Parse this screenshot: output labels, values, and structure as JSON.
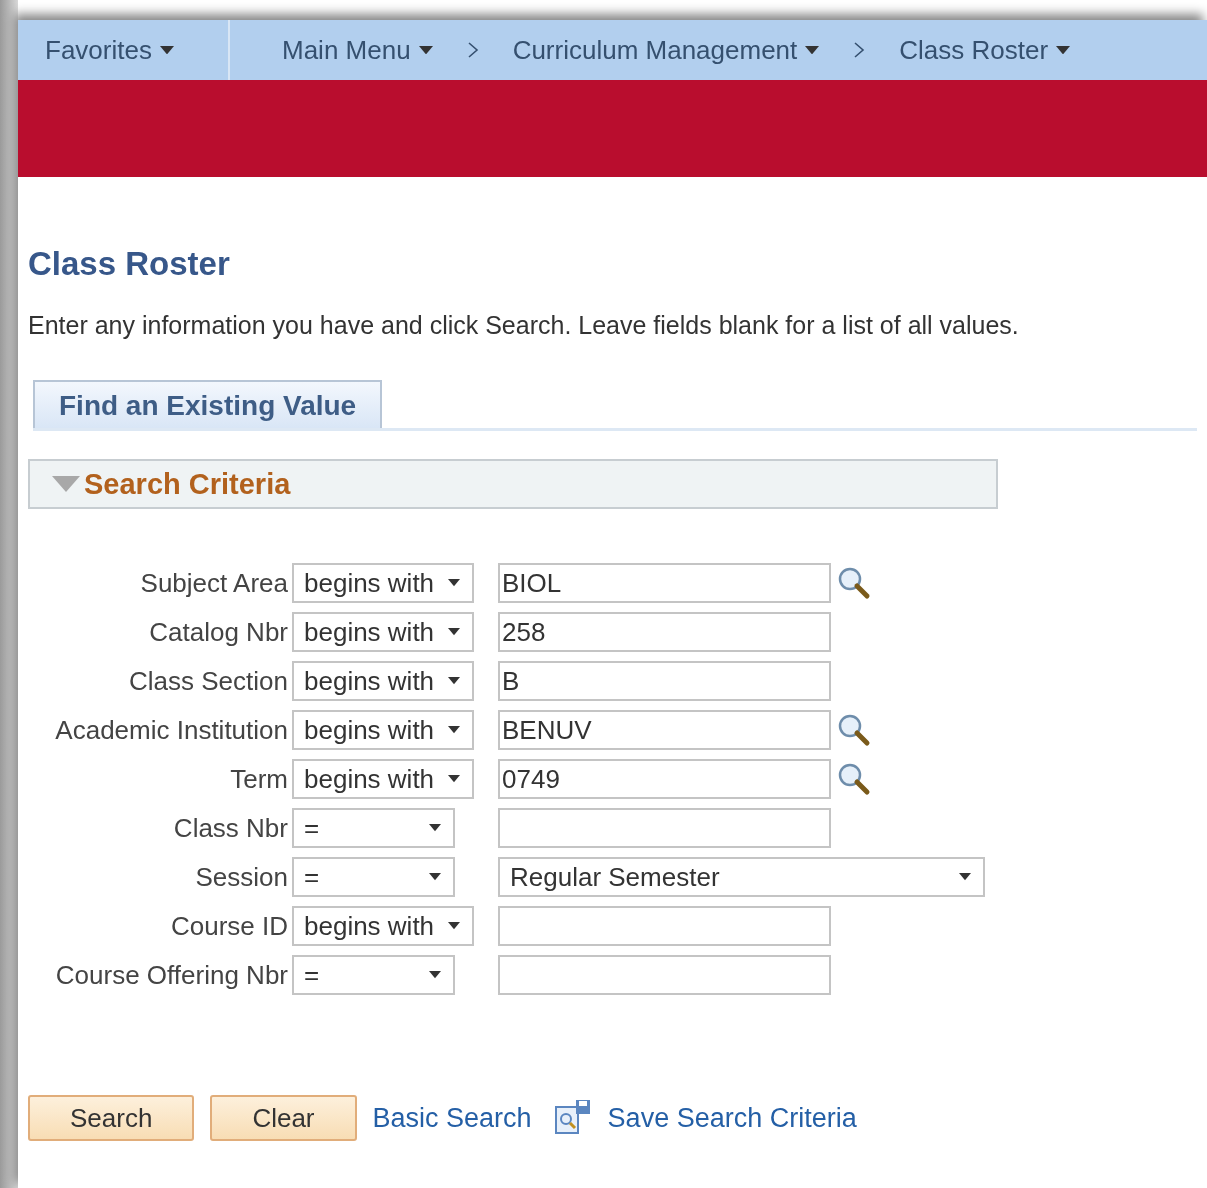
{
  "nav": {
    "favorites": "Favorites",
    "breadcrumbs": [
      "Main Menu",
      "Curriculum Management",
      "Class Roster"
    ]
  },
  "page_title": "Class Roster",
  "instructions": "Enter any information you have and click Search. Leave fields blank for a list of all values.",
  "tabs": [
    {
      "label": "Find an Existing Value",
      "selected": true
    }
  ],
  "section": {
    "title": "Search Criteria",
    "expanded": true
  },
  "criteria": [
    {
      "label": "Subject Area",
      "operator": "begins with",
      "kind": "text",
      "value": "BIOL",
      "lookup": true
    },
    {
      "label": "Catalog Nbr",
      "operator": "begins with",
      "kind": "text",
      "value": "258",
      "lookup": false
    },
    {
      "label": "Class Section",
      "operator": "begins with",
      "kind": "text",
      "value": "B",
      "lookup": false
    },
    {
      "label": "Academic Institution",
      "operator": "begins with",
      "kind": "text",
      "value": "BENUV",
      "lookup": true
    },
    {
      "label": "Term",
      "operator": "begins with",
      "kind": "text",
      "value": "0749",
      "lookup": true
    },
    {
      "label": "Class Nbr",
      "operator": "=",
      "kind": "text",
      "lookup": false
    },
    {
      "label": "Session",
      "operator": "=",
      "kind": "select",
      "value": "Regular Semester",
      "lookup": false
    },
    {
      "label": "Course ID",
      "operator": "begins with",
      "kind": "text",
      "lookup": false
    },
    {
      "label": "Course Offering Nbr",
      "operator": "=",
      "kind": "text",
      "lookup": false
    }
  ],
  "buttons": [
    "Search",
    "Clear"
  ],
  "links": {
    "basic_search": "Basic Search",
    "save_criteria": "Save Search Criteria"
  }
}
